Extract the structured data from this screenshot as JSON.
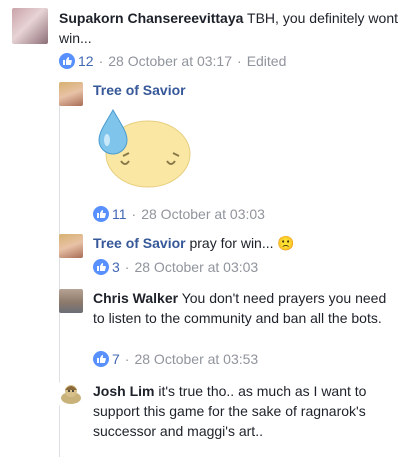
{
  "comments": [
    {
      "author": "Supakorn Chansereevittaya",
      "text": "TBH, you definitely wont win...",
      "likes": "12",
      "time": "28 October at 03:17",
      "edited": "Edited"
    },
    {
      "author": "Tree of Savior",
      "sticker": "sweating-face-sticker",
      "likes": "11",
      "time": "28 October at 03:03"
    },
    {
      "author": "Tree of Savior",
      "text": "pray for win...",
      "emoji": "🙁",
      "likes": "3",
      "time": "28 October at 03:03"
    },
    {
      "author": "Chris Walker",
      "text": "You don't need prayers you need to listen to the community and ban all the bots.",
      "likes": "7",
      "time": "28 October at 03:53"
    },
    {
      "author": "Josh Lim",
      "text": "it's true tho.. as much as I want to support this game for the sake of ragnarok's successor and maggi's art.."
    }
  ],
  "colors": {
    "link": "#365899",
    "meta": "#90949c",
    "like": "#5890ff"
  }
}
